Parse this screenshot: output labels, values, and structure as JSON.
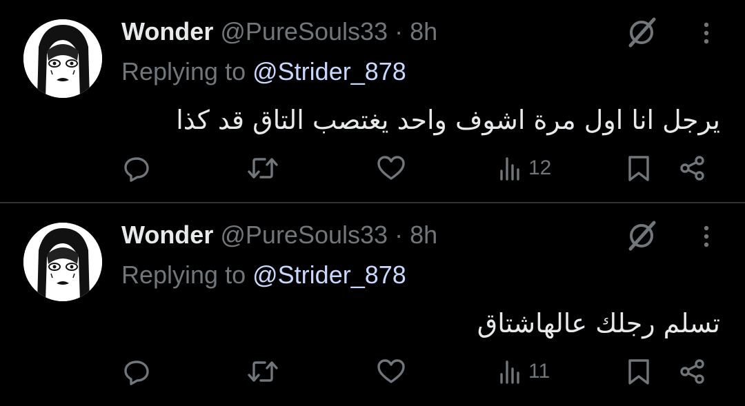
{
  "colors": {
    "background": "#000000",
    "text": "#e7e9ea",
    "muted": "#71767b",
    "mention": "#c9d8ff",
    "divider": "#2f3336"
  },
  "tweets": [
    {
      "display_name": "Wonder",
      "handle": "@PureSouls33",
      "separator": "·",
      "time": "8h",
      "replying_prefix": "Replying to",
      "replying_to": "@Strider_878",
      "text": "يرجل انا اول مرة اشوف واحد يغتصب التاق قد كذا",
      "views": "12",
      "icons": [
        "avatar",
        "grok-icon",
        "more-icon",
        "reply-icon",
        "retweet-icon",
        "like-icon",
        "views-icon",
        "bookmark-icon",
        "share-icon"
      ]
    },
    {
      "display_name": "Wonder",
      "handle": "@PureSouls33",
      "separator": "·",
      "time": "8h",
      "replying_prefix": "Replying to",
      "replying_to": "@Strider_878",
      "text": "تسلم رجلك عالهاشتاق",
      "views": "11",
      "icons": [
        "avatar",
        "grok-icon",
        "more-icon",
        "reply-icon",
        "retweet-icon",
        "like-icon",
        "views-icon",
        "bookmark-icon",
        "share-icon"
      ]
    }
  ]
}
